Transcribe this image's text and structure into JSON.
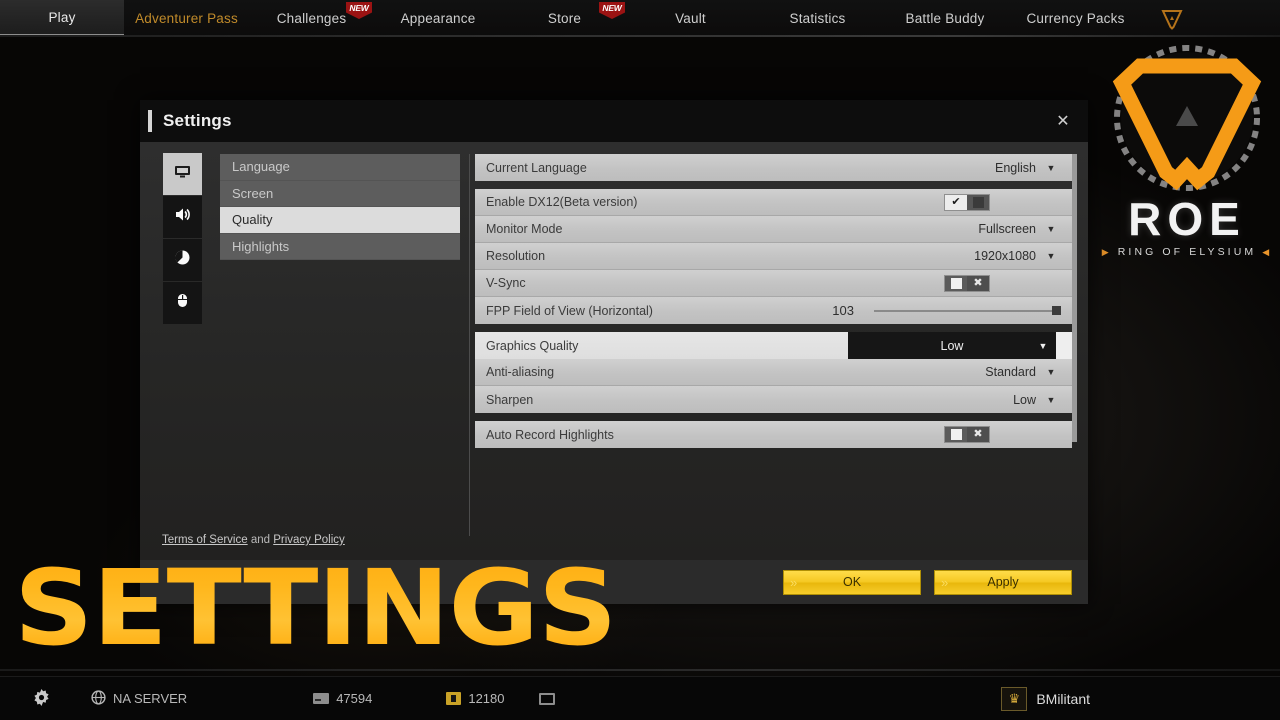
{
  "topnav": {
    "items": [
      {
        "label": "Play",
        "active": true,
        "badge": null,
        "style": "plain"
      },
      {
        "label": "Adventurer Pass",
        "active": false,
        "badge": null,
        "style": "gold"
      },
      {
        "label": "Challenges",
        "active": false,
        "badge": "NEW",
        "style": "plain"
      },
      {
        "label": "Appearance",
        "active": false,
        "badge": null,
        "style": "plain"
      },
      {
        "label": "Store",
        "active": false,
        "badge": "NEW",
        "style": "plain"
      },
      {
        "label": "Vault",
        "active": false,
        "badge": null,
        "style": "plain"
      },
      {
        "label": "Statistics",
        "active": false,
        "badge": null,
        "style": "plain"
      },
      {
        "label": "Battle Buddy",
        "active": false,
        "badge": null,
        "style": "plain"
      },
      {
        "label": "Currency Packs",
        "active": false,
        "badge": null,
        "style": "plain"
      }
    ]
  },
  "logo": {
    "word": "ROE",
    "subtitle": "RING OF ELYSIUM",
    "arrow_left": "▶",
    "arrow_right": "◀",
    "accent_color": "#f59b17"
  },
  "dialog": {
    "title": "Settings",
    "close_icon": "✕",
    "rail": [
      {
        "name": "display",
        "icon": "monitor-icon",
        "active": true
      },
      {
        "name": "audio",
        "icon": "speaker-icon",
        "active": false
      },
      {
        "name": "gameplay",
        "icon": "gameplay-icon",
        "active": false
      },
      {
        "name": "controls",
        "icon": "mouse-icon",
        "active": false
      }
    ],
    "categories": [
      {
        "label": "Language",
        "selected": false
      },
      {
        "label": "Screen",
        "selected": false
      },
      {
        "label": "Quality",
        "selected": true
      },
      {
        "label": "Highlights",
        "selected": false
      }
    ],
    "groups": [
      {
        "rows": [
          {
            "type": "dropdown",
            "label": "Current Language",
            "value": "English"
          }
        ]
      },
      {
        "rows": [
          {
            "type": "toggle",
            "label": "Enable DX12(Beta version)",
            "state": "on",
            "on_mark": "✔"
          },
          {
            "type": "dropdown",
            "label": "Monitor Mode",
            "value": "Fullscreen"
          },
          {
            "type": "dropdown",
            "label": "Resolution",
            "value": "1920x1080"
          },
          {
            "type": "toggle",
            "label": "V-Sync",
            "state": "off",
            "off_mark": "✖"
          },
          {
            "type": "slider",
            "label": "FPP Field of View (Horizontal)",
            "value": "103",
            "percent": 96
          }
        ]
      },
      {
        "rows": [
          {
            "type": "dropdown-highlight",
            "label": "Graphics Quality",
            "value": "Low",
            "highlighted": true
          },
          {
            "type": "dropdown",
            "label": "Anti-aliasing",
            "value": "Standard"
          },
          {
            "type": "dropdown",
            "label": "Sharpen",
            "value": "Low"
          }
        ]
      },
      {
        "rows": [
          {
            "type": "toggle",
            "label": "Auto Record Highlights",
            "state": "off",
            "off_mark": "✖"
          }
        ]
      }
    ],
    "caret_icon": "▼",
    "terms": {
      "tos": "Terms of Service",
      "conjunction": " and ",
      "privacy": "Privacy Policy"
    },
    "buttons": {
      "ok": "OK",
      "apply": "Apply",
      "chevron": "»"
    }
  },
  "overlay": {
    "word": "SETTINGS",
    "color": "#ffb31e"
  },
  "bottombar": {
    "gear_icon": "⚙",
    "server_icon": "ἱ0",
    "server": "NA SERVER",
    "coin_value": "47594",
    "ticket_value": "12180",
    "mail_icon": "mail-icon",
    "player_name": "BMilitant",
    "crown_icon": "♛"
  }
}
